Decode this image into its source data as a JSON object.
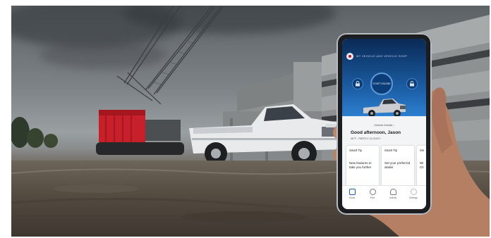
{
  "phone": {
    "status_time": "",
    "nav_links": "MY VEHICLE   ADD VEHICLE   SHOP",
    "start_label": "START ENGINE",
    "vehicle_details": "Vehicle Details ›",
    "greeting": "Good afternoon, Jason",
    "weather": "46°F · PARTLY CLOUDY",
    "cards": [
      {
        "title": "Smart Tip",
        "text": "New features to take you further"
      },
      {
        "title": "Smart Tip",
        "text": "Set your preferred dealer"
      },
      {
        "title": "Sm",
        "text": "Wi Ch"
      }
    ],
    "tabs": [
      "Home",
      "Find",
      "Activity",
      "Settings"
    ]
  },
  "colors": {
    "app_blue": "#1a5aa0",
    "truck_white": "#e8eaec",
    "crane_red": "#c8202a"
  }
}
